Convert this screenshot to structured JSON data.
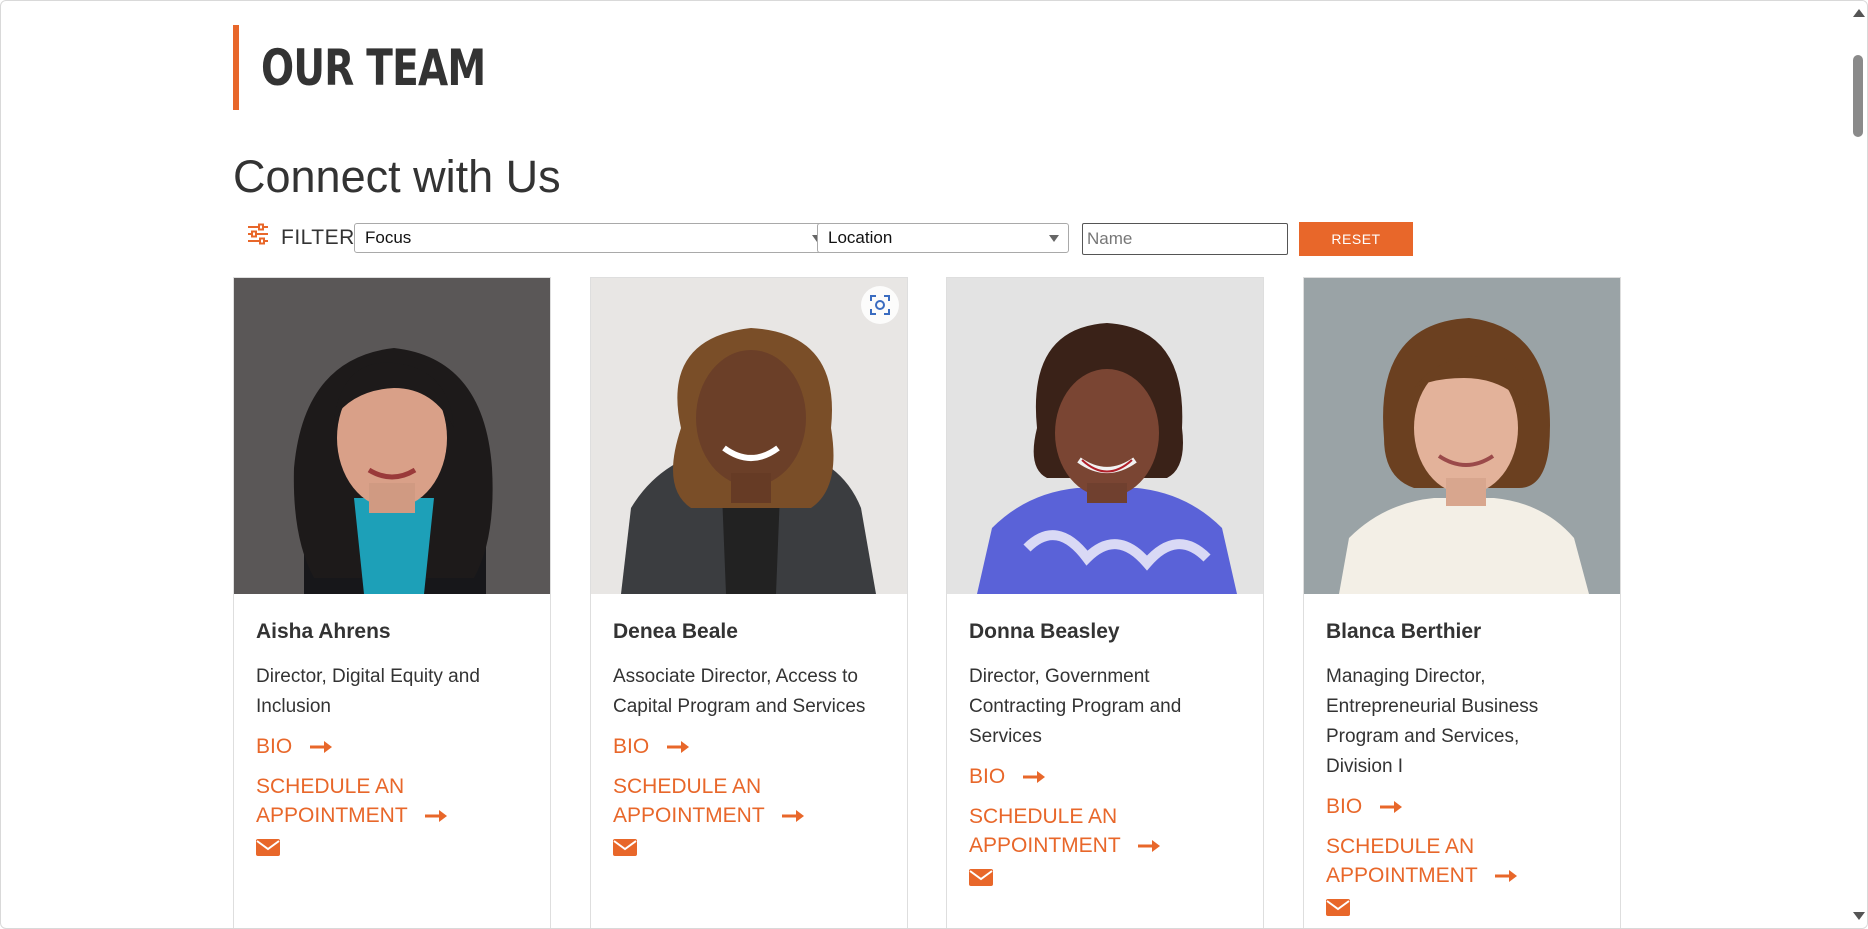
{
  "header": {
    "title": "OUR TEAM",
    "subtitle": "Connect with Us"
  },
  "filter": {
    "label": "FILTER",
    "focus_value": "Focus",
    "location_value": "Location",
    "name_placeholder": "Name",
    "reset_label": "RESET"
  },
  "colors": {
    "accent": "#e8672a",
    "text": "#333333"
  },
  "cards": [
    {
      "name": "Aisha Ahrens",
      "title_lines": [
        "Director, Digital Equity and",
        "Inclusion"
      ],
      "bio_label": "BIO",
      "schedule_lines": [
        "SCHEDULE AN",
        "APPOINTMENT"
      ],
      "icon": "envelope-icon"
    },
    {
      "name": "Denea Beale",
      "title_lines": [
        "Associate Director, Access to",
        "Capital Program and Services"
      ],
      "bio_label": "BIO",
      "schedule_lines": [
        "SCHEDULE AN",
        "APPOINTMENT"
      ],
      "icon": "envelope-icon"
    },
    {
      "name": "Donna Beasley",
      "title_lines": [
        "Director, Government",
        "Contracting Program and",
        "Services"
      ],
      "bio_label": "BIO",
      "schedule_lines": [
        "SCHEDULE AN",
        "APPOINTMENT"
      ],
      "icon": "envelope-icon"
    },
    {
      "name": "Blanca Berthier",
      "title_lines": [
        "Managing Director,",
        "Entrepreneurial Business",
        "Program and Services,",
        "Division I"
      ],
      "bio_label": "BIO",
      "schedule_lines": [
        "SCHEDULE AN",
        "APPOINTMENT"
      ],
      "icon": "envelope-icon"
    }
  ]
}
